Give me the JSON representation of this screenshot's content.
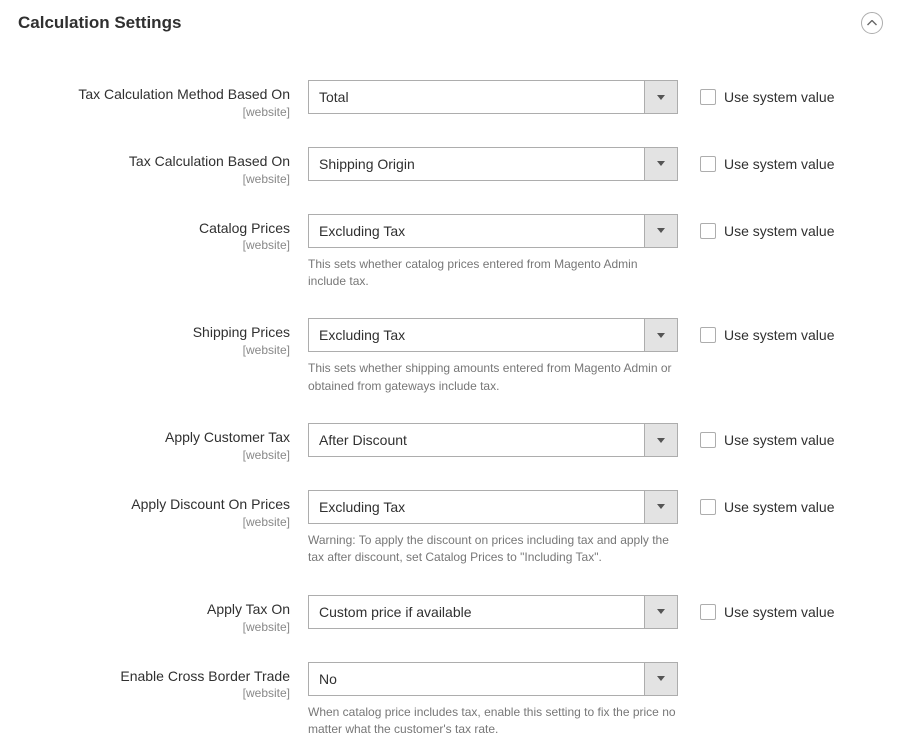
{
  "section": {
    "title": "Calculation Settings"
  },
  "common": {
    "scope": "[website]",
    "use_system_label": "Use system value"
  },
  "fields": {
    "method": {
      "label": "Tax Calculation Method Based On",
      "value": "Total"
    },
    "based_on": {
      "label": "Tax Calculation Based On",
      "value": "Shipping Origin"
    },
    "catalog": {
      "label": "Catalog Prices",
      "value": "Excluding Tax",
      "help": "This sets whether catalog prices entered from Magento Admin include tax."
    },
    "shipping": {
      "label": "Shipping Prices",
      "value": "Excluding Tax",
      "help": "This sets whether shipping amounts entered from Magento Admin or obtained from gateways include tax."
    },
    "customer_tax": {
      "label": "Apply Customer Tax",
      "value": "After Discount"
    },
    "discount": {
      "label": "Apply Discount On Prices",
      "value": "Excluding Tax",
      "help": "Warning: To apply the discount on prices including tax and apply the tax after discount, set Catalog Prices to \"Including Tax\"."
    },
    "tax_on": {
      "label": "Apply Tax On",
      "value": "Custom price if available"
    },
    "cross_border": {
      "label": "Enable Cross Border Trade",
      "value": "No",
      "help": "When catalog price includes tax, enable this setting to fix the price no matter what the customer's tax rate."
    }
  }
}
